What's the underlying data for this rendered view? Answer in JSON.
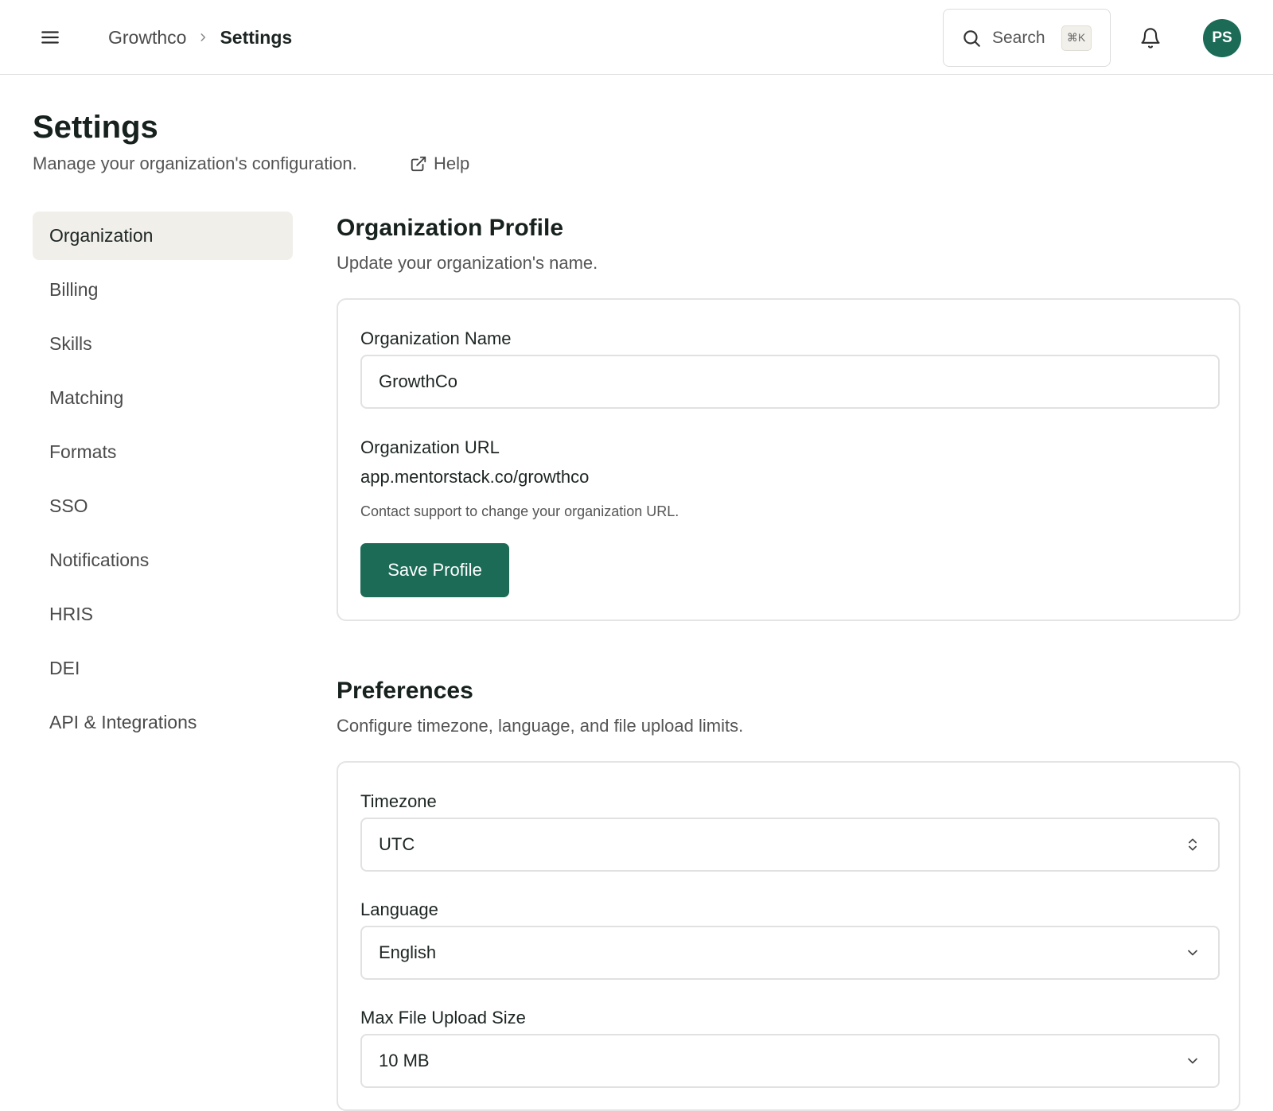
{
  "header": {
    "breadcrumb": {
      "org": "Growthco",
      "current": "Settings"
    },
    "search": {
      "label": "Search",
      "shortcut": "⌘K"
    },
    "avatar_initials": "PS"
  },
  "page": {
    "title": "Settings",
    "description": "Manage your organization's configuration.",
    "help_label": "Help"
  },
  "sidebar": {
    "items": [
      {
        "label": "Organization",
        "active": true
      },
      {
        "label": "Billing"
      },
      {
        "label": "Skills"
      },
      {
        "label": "Matching"
      },
      {
        "label": "Formats"
      },
      {
        "label": "SSO"
      },
      {
        "label": "Notifications"
      },
      {
        "label": "HRIS"
      },
      {
        "label": "DEI"
      },
      {
        "label": "API & Integrations"
      }
    ]
  },
  "profile": {
    "title": "Organization Profile",
    "description": "Update your organization's name.",
    "name_label": "Organization Name",
    "name_value": "GrowthCo",
    "url_label": "Organization URL",
    "url_value": "app.mentorstack.co/growthco",
    "url_hint": "Contact support to change your organization URL.",
    "save_label": "Save Profile"
  },
  "preferences": {
    "title": "Preferences",
    "description": "Configure timezone, language, and file upload limits.",
    "timezone_label": "Timezone",
    "timezone_value": "UTC",
    "language_label": "Language",
    "language_value": "English",
    "upload_label": "Max File Upload Size",
    "upload_value": "10 MB"
  },
  "colors": {
    "brand": "#1b6b57",
    "active_nav_bg": "#f1efea",
    "border": "#e1e1e1"
  },
  "icons": [
    "menu-icon",
    "chevron-right-icon",
    "search-icon",
    "bell-icon",
    "external-link-icon",
    "up-down-chevron-icon",
    "chevron-down-icon"
  ]
}
